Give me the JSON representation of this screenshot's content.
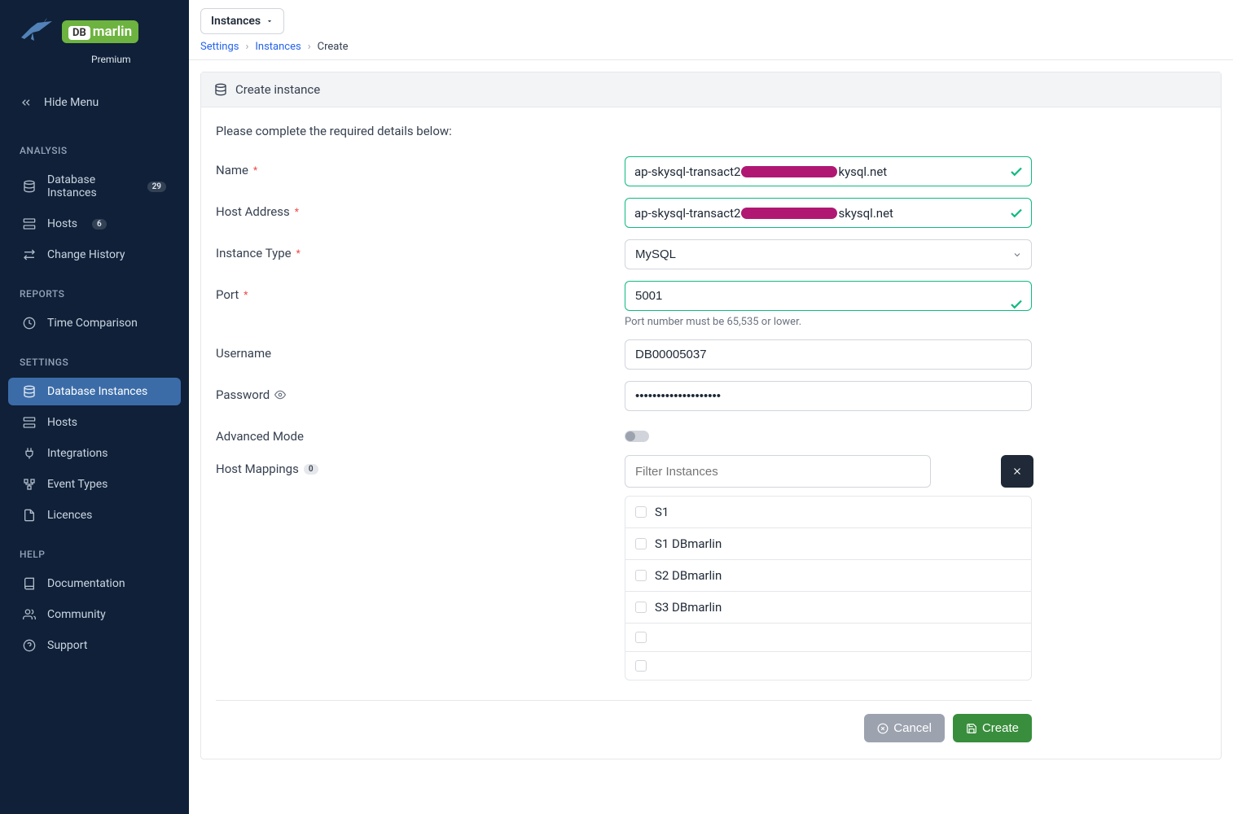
{
  "brand": {
    "db": "DB",
    "marlin": "marlin",
    "tier": "Premium"
  },
  "hideMenu": "Hide Menu",
  "sections": {
    "analysis": "ANALYSIS",
    "reports": "REPORTS",
    "settings": "SETTINGS",
    "help": "HELP"
  },
  "nav": {
    "analysis": [
      {
        "label": "Database Instances",
        "badge": "29"
      },
      {
        "label": "Hosts",
        "badge": "6"
      },
      {
        "label": "Change History"
      }
    ],
    "reports": [
      {
        "label": "Time Comparison"
      }
    ],
    "settings": [
      {
        "label": "Database Instances",
        "active": true
      },
      {
        "label": "Hosts"
      },
      {
        "label": "Integrations"
      },
      {
        "label": "Event Types"
      },
      {
        "label": "Licences"
      }
    ],
    "help": [
      {
        "label": "Documentation"
      },
      {
        "label": "Community"
      },
      {
        "label": "Support"
      }
    ]
  },
  "topDropdown": "Instances",
  "breadcrumbs": {
    "a": "Settings",
    "b": "Instances",
    "c": "Create"
  },
  "panel": {
    "title": "Create instance",
    "instructions": "Please complete the required details below:"
  },
  "form": {
    "name": {
      "label": "Name",
      "prefix": "ap-skysql-transact2",
      "suffix": "kysql.net"
    },
    "host": {
      "label": "Host Address",
      "prefix": "ap-skysql-transact2",
      "suffix": "skysql.net"
    },
    "type": {
      "label": "Instance Type",
      "value": "MySQL"
    },
    "port": {
      "label": "Port",
      "value": "5001",
      "help": "Port number must be 65,535 or lower."
    },
    "username": {
      "label": "Username",
      "value": "DB00005037"
    },
    "password": {
      "label": "Password",
      "value": "••••••••••••••••••••"
    },
    "advanced": {
      "label": "Advanced Mode"
    },
    "hostMappings": {
      "label": "Host Mappings",
      "badge": "0",
      "filterPlaceholder": "Filter Instances"
    },
    "hosts": [
      "S1",
      "S1 DBmarlin",
      "S2 DBmarlin",
      "S3 DBmarlin",
      "",
      ""
    ]
  },
  "actions": {
    "cancel": "Cancel",
    "create": "Create"
  }
}
